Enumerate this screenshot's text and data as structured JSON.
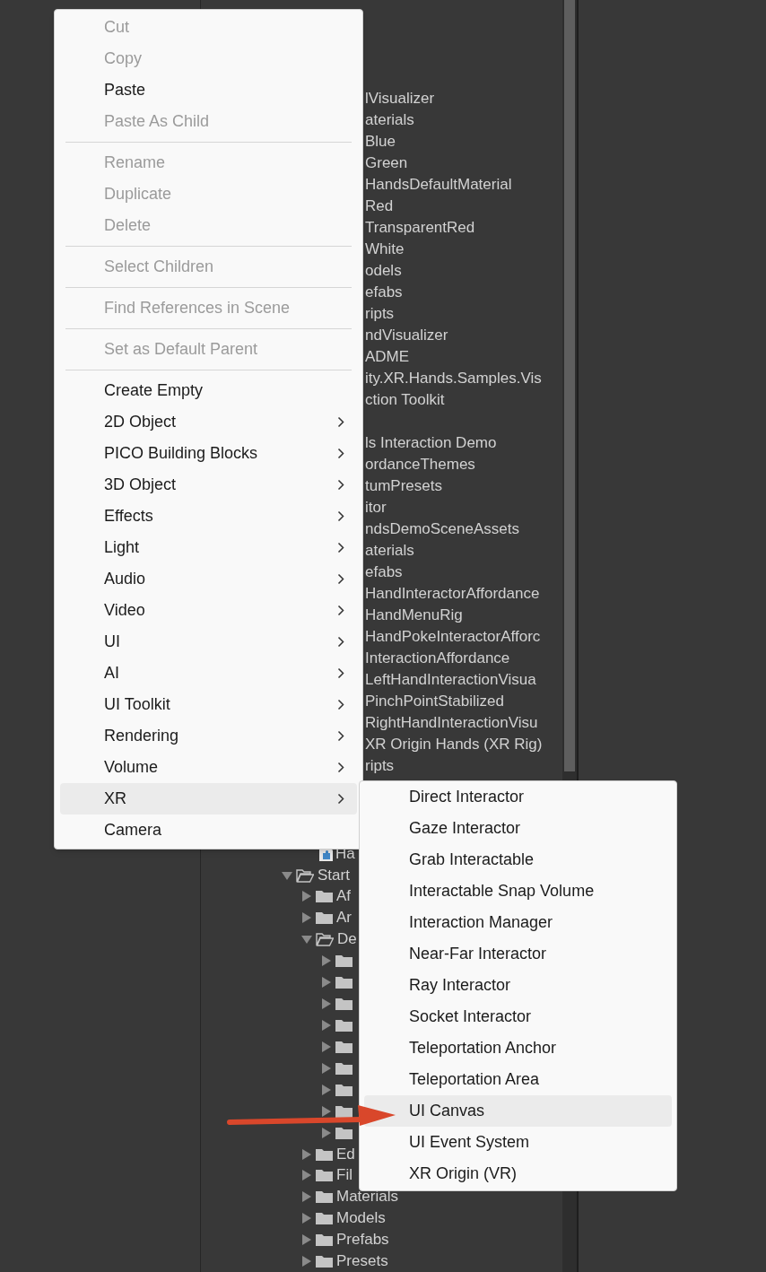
{
  "tree_upper": [
    {
      "label": "lVisualizer"
    },
    {
      "label": "aterials"
    },
    {
      "label": "Blue"
    },
    {
      "label": "Green"
    },
    {
      "label": "HandsDefaultMaterial"
    },
    {
      "label": "Red"
    },
    {
      "label": "TransparentRed"
    },
    {
      "label": "White"
    },
    {
      "label": "odels"
    },
    {
      "label": "efabs"
    },
    {
      "label": "ripts"
    },
    {
      "label": "ndVisualizer"
    },
    {
      "label": "ADME"
    },
    {
      "label": "ity.XR.Hands.Samples.Vis"
    },
    {
      "label": "ction Toolkit"
    }
  ],
  "tree_middle": [
    {
      "label": "ls Interaction Demo"
    },
    {
      "label": "ordanceThemes"
    },
    {
      "label": "tumPresets"
    },
    {
      "label": "itor"
    },
    {
      "label": "ndsDemoSceneAssets"
    },
    {
      "label": "aterials"
    },
    {
      "label": "efabs"
    },
    {
      "label": "HandInteractorAffordance"
    },
    {
      "label": "HandMenuRig"
    },
    {
      "label": "HandPokeInteractorAfforc"
    },
    {
      "label": "InteractionAffordance"
    },
    {
      "label": "LeftHandInteractionVisua"
    },
    {
      "label": "PinchPointStabilized"
    },
    {
      "label": "RightHandInteractionVisu"
    },
    {
      "label": "XR Origin Hands (XR Rig)"
    },
    {
      "label": "ripts"
    }
  ],
  "tree_lower": [
    {
      "kind": "script",
      "label": "Ha"
    },
    {
      "kind": "folder",
      "label": "Start",
      "expanded": true,
      "children": [
        {
          "kind": "folder",
          "label": "Af",
          "expanded": false
        },
        {
          "kind": "folder",
          "label": "Ar",
          "expanded": false
        },
        {
          "kind": "folder",
          "label": "De",
          "expanded": true,
          "children": [
            {
              "kind": "folder",
              "expanded": false
            },
            {
              "kind": "folder",
              "expanded": false
            },
            {
              "kind": "folder",
              "expanded": false
            },
            {
              "kind": "folder",
              "expanded": false
            },
            {
              "kind": "folder",
              "expanded": false
            },
            {
              "kind": "folder",
              "expanded": false
            },
            {
              "kind": "folder",
              "expanded": false
            },
            {
              "kind": "folder",
              "expanded": false
            },
            {
              "kind": "folder",
              "expanded": false
            }
          ]
        },
        {
          "kind": "folder",
          "label": "Ed",
          "expanded": false
        },
        {
          "kind": "folder",
          "label": "Fil",
          "expanded": false
        },
        {
          "kind": "folder",
          "label": "Materials",
          "expanded": false
        },
        {
          "kind": "folder",
          "label": "Models",
          "expanded": false
        },
        {
          "kind": "folder",
          "label": "Prefabs",
          "expanded": false
        },
        {
          "kind": "folder",
          "label": "Presets",
          "expanded": false
        }
      ]
    }
  ],
  "context_menu": [
    {
      "kind": "item",
      "label": "Cut",
      "disabled": true,
      "submenu": false,
      "selected": false
    },
    {
      "kind": "item",
      "label": "Copy",
      "disabled": true,
      "submenu": false,
      "selected": false
    },
    {
      "kind": "item",
      "label": "Paste",
      "disabled": false,
      "submenu": false,
      "selected": false
    },
    {
      "kind": "item",
      "label": "Paste As Child",
      "disabled": true,
      "submenu": false,
      "selected": false
    },
    {
      "kind": "separator"
    },
    {
      "kind": "item",
      "label": "Rename",
      "disabled": true,
      "submenu": false,
      "selected": false
    },
    {
      "kind": "item",
      "label": "Duplicate",
      "disabled": true,
      "submenu": false,
      "selected": false
    },
    {
      "kind": "item",
      "label": "Delete",
      "disabled": true,
      "submenu": false,
      "selected": false
    },
    {
      "kind": "separator"
    },
    {
      "kind": "item",
      "label": "Select Children",
      "disabled": true,
      "submenu": false,
      "selected": false
    },
    {
      "kind": "separator"
    },
    {
      "kind": "item",
      "label": "Find References in Scene",
      "disabled": true,
      "submenu": false,
      "selected": false
    },
    {
      "kind": "separator"
    },
    {
      "kind": "item",
      "label": "Set as Default Parent",
      "disabled": true,
      "submenu": false,
      "selected": false
    },
    {
      "kind": "separator"
    },
    {
      "kind": "item",
      "label": "Create Empty",
      "disabled": false,
      "submenu": false,
      "selected": false
    },
    {
      "kind": "item",
      "label": "2D Object",
      "disabled": false,
      "submenu": true,
      "selected": false
    },
    {
      "kind": "item",
      "label": "PICO Building Blocks",
      "disabled": false,
      "submenu": true,
      "selected": false
    },
    {
      "kind": "item",
      "label": "3D Object",
      "disabled": false,
      "submenu": true,
      "selected": false
    },
    {
      "kind": "item",
      "label": "Effects",
      "disabled": false,
      "submenu": true,
      "selected": false
    },
    {
      "kind": "item",
      "label": "Light",
      "disabled": false,
      "submenu": true,
      "selected": false
    },
    {
      "kind": "item",
      "label": "Audio",
      "disabled": false,
      "submenu": true,
      "selected": false
    },
    {
      "kind": "item",
      "label": "Video",
      "disabled": false,
      "submenu": true,
      "selected": false
    },
    {
      "kind": "item",
      "label": "UI",
      "disabled": false,
      "submenu": true,
      "selected": false
    },
    {
      "kind": "item",
      "label": "AI",
      "disabled": false,
      "submenu": true,
      "selected": false
    },
    {
      "kind": "item",
      "label": "UI Toolkit",
      "disabled": false,
      "submenu": true,
      "selected": false
    },
    {
      "kind": "item",
      "label": "Rendering",
      "disabled": false,
      "submenu": true,
      "selected": false
    },
    {
      "kind": "item",
      "label": "Volume",
      "disabled": false,
      "submenu": true,
      "selected": false
    },
    {
      "kind": "item",
      "label": "XR",
      "disabled": false,
      "submenu": true,
      "selected": true
    },
    {
      "kind": "item",
      "label": "Camera",
      "disabled": false,
      "submenu": false,
      "selected": false
    }
  ],
  "xr_submenu": [
    {
      "label": "Direct Interactor",
      "selected": false
    },
    {
      "label": "Gaze Interactor",
      "selected": false
    },
    {
      "label": "Grab Interactable",
      "selected": false
    },
    {
      "label": "Interactable Snap Volume",
      "selected": false
    },
    {
      "label": "Interaction Manager",
      "selected": false
    },
    {
      "label": "Near-Far Interactor",
      "selected": false
    },
    {
      "label": "Ray Interactor",
      "selected": false
    },
    {
      "label": "Socket Interactor",
      "selected": false
    },
    {
      "label": "Teleportation Anchor",
      "selected": false
    },
    {
      "label": "Teleportation Area",
      "selected": false
    },
    {
      "label": "UI Canvas",
      "selected": true
    },
    {
      "label": "UI Event System",
      "selected": false
    },
    {
      "label": "XR Origin (VR)",
      "selected": false
    }
  ]
}
